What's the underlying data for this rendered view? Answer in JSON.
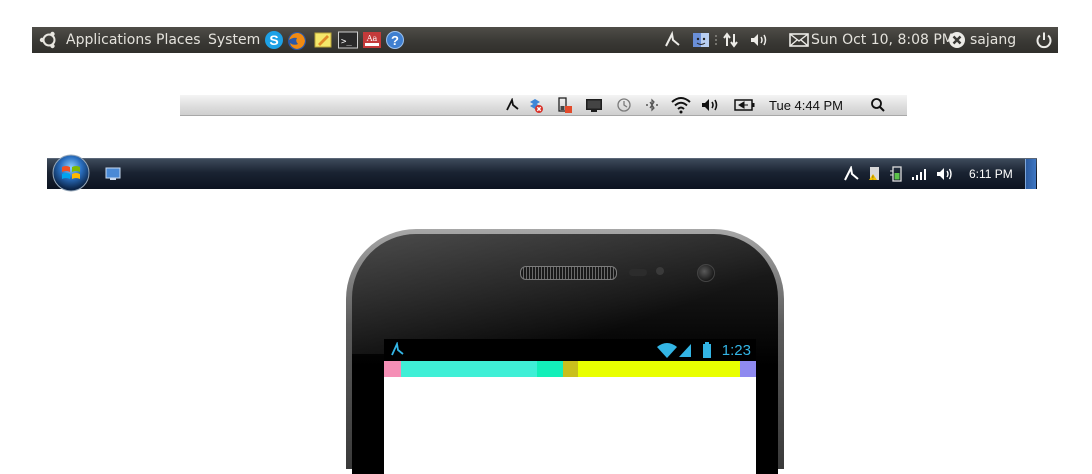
{
  "ubuntu_panel": {
    "menus": [
      "Applications",
      "Places",
      "System"
    ],
    "launchers": [
      "skype-icon",
      "firefox-icon",
      "text-editor-icon",
      "terminal-icon",
      "dictionary-icon",
      "help-icon"
    ],
    "dictionary_label": "Aa",
    "help_label": "?",
    "terminal_label": ">_",
    "clock": "Sun Oct 10,  8:08 PM",
    "user": "sajang",
    "tray_icons": [
      "app-indicator-icon",
      "finder-icon",
      "network-arrows-icon",
      "volume-icon",
      "mail-icon",
      "user-status-icon",
      "power-icon"
    ]
  },
  "mac_bar": {
    "clock": "Tue 4:44 PM",
    "tray_icons": [
      "app-indicator-icon",
      "sync-error-icon",
      "battery-warning-icon",
      "display-icon",
      "time-machine-icon",
      "bluetooth-icon",
      "wifi-icon",
      "volume-icon",
      "battery-icon",
      "spotlight-icon"
    ]
  },
  "win_bar": {
    "clock": "6:11 PM",
    "tray_icons": [
      "app-indicator-icon",
      "security-icon",
      "battery-plug-icon",
      "signal-bars-icon",
      "volume-icon"
    ]
  },
  "phone": {
    "clock": "1:23",
    "status_icons": [
      "app-indicator-icon",
      "wifi-icon",
      "signal-icon",
      "battery-icon"
    ],
    "colors": {
      "accent": "#33b5e5"
    },
    "color_bar": [
      {
        "color": "#f58fb6",
        "weight": 17
      },
      {
        "color": "#3fefd6",
        "weight": 136
      },
      {
        "color": "#13efb9",
        "weight": 26
      },
      {
        "color": "#c9c01d",
        "weight": 15
      },
      {
        "color": "#e9ff00",
        "weight": 162
      },
      {
        "color": "#8f8af0",
        "weight": 16
      }
    ]
  }
}
